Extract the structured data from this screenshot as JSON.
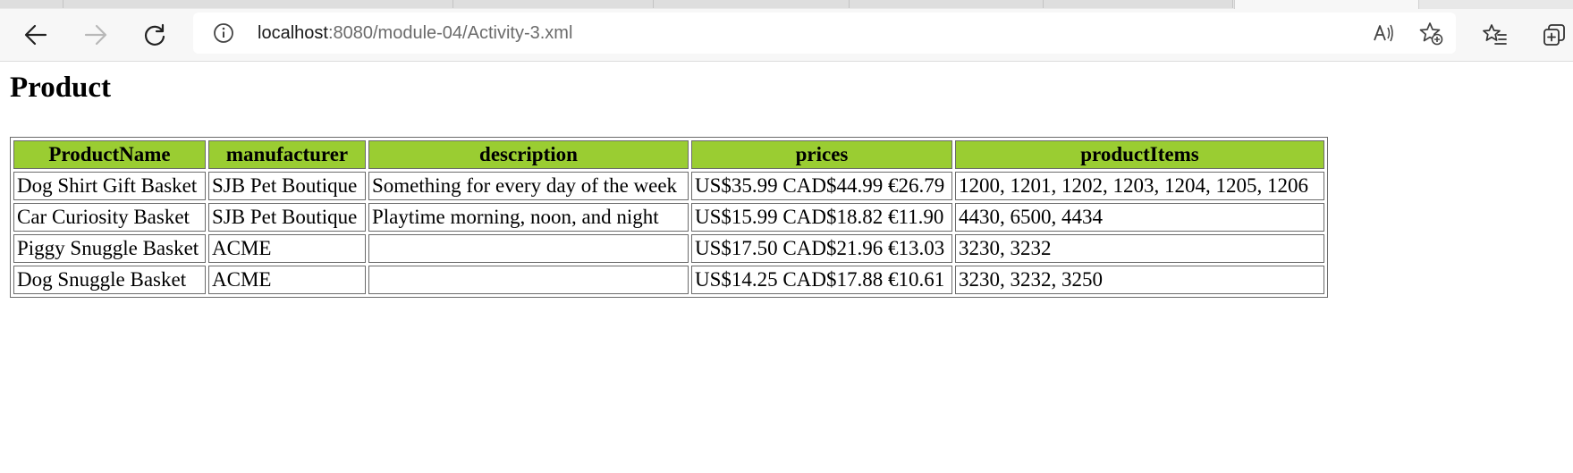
{
  "browser": {
    "url_host": "localhost",
    "url_path": ":8080/module-04/Activity-3.xml",
    "icons": {
      "back": "back-arrow-icon",
      "forward": "forward-arrow-icon",
      "refresh": "refresh-icon",
      "site_info": "info-icon",
      "read_aloud": "read-aloud-icon",
      "add_favorite": "add-favorite-icon",
      "favorites": "favorites-icon",
      "collections": "collections-icon"
    }
  },
  "page": {
    "title": "Product",
    "header_color": "#9acd32",
    "columns": [
      "ProductName",
      "manufacturer",
      "description",
      "prices",
      "productItems"
    ],
    "rows": [
      [
        "Dog Shirt Gift Basket",
        "SJB Pet Boutique",
        "Something for every day of the week",
        "US$35.99 CAD$44.99 €26.79",
        "1200, 1201, 1202, 1203, 1204, 1205, 1206"
      ],
      [
        "Car Curiosity Basket",
        "SJB Pet Boutique",
        "Playtime morning, noon, and night",
        "US$15.99 CAD$18.82 €11.90",
        "4430, 6500, 4434"
      ],
      [
        "Piggy Snuggle Basket",
        "ACME",
        "",
        "US$17.50 CAD$21.96 €13.03",
        "3230, 3232"
      ],
      [
        "Dog Snuggle Basket",
        "ACME",
        "",
        "US$14.25 CAD$17.88 €10.61",
        "3230, 3232, 3250"
      ]
    ]
  }
}
